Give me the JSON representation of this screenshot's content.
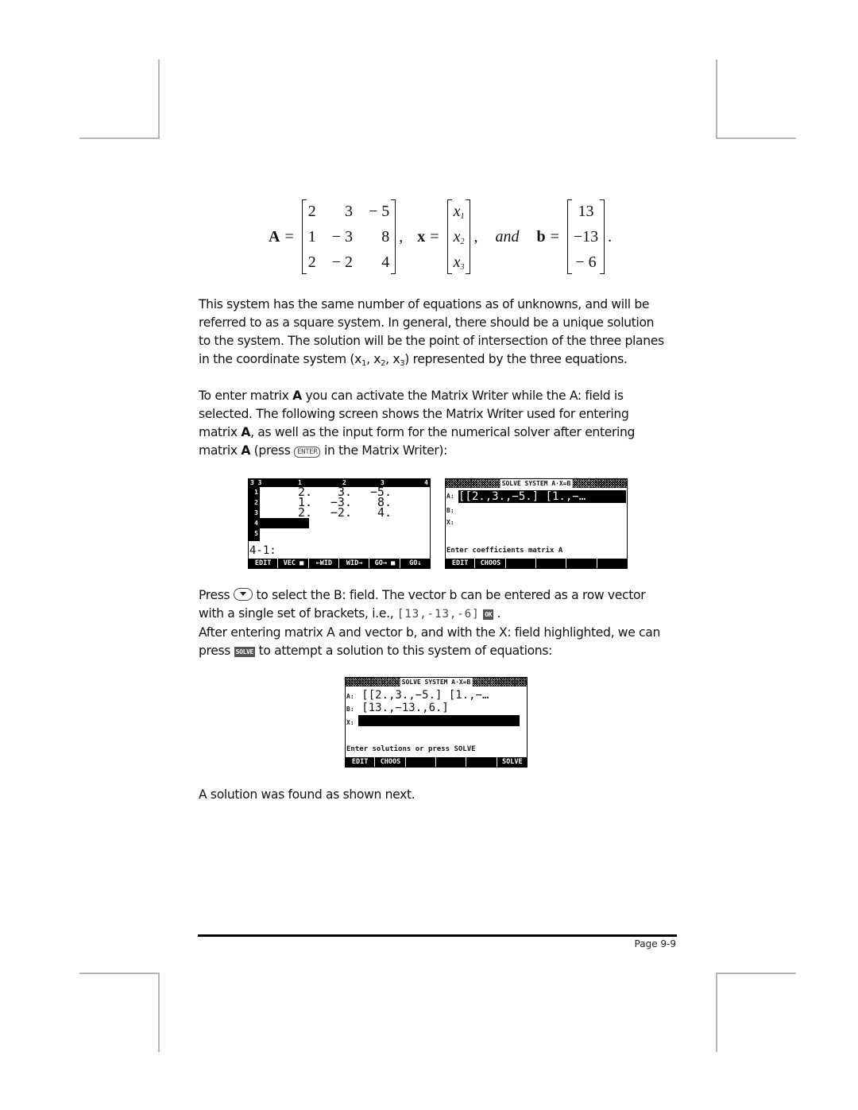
{
  "equation": {
    "A_label": "A",
    "A": [
      [
        "2",
        "3",
        "− 5"
      ],
      [
        "1",
        "− 3",
        "8"
      ],
      [
        "2",
        "− 2",
        "4"
      ]
    ],
    "x_label": "x",
    "x": [
      "x",
      "x",
      "x"
    ],
    "x_subs": [
      "1",
      "2",
      "3"
    ],
    "and_label": "and",
    "b_label": "b",
    "b": [
      "13",
      "−13",
      "− 6"
    ],
    "equals": "=",
    "comma": ",",
    "period": "."
  },
  "para1": {
    "line1": "This system has the same number of equations as of unknowns, and will be",
    "line2": "referred to as a square system.  In general, there should be a unique solution",
    "line3": "to the system.  The solution will be the point of intersection of the three planes",
    "line4_a": "in the coordinate system (x",
    "line4_s1": "1",
    "line4_b": ", x",
    "line4_s2": "2",
    "line4_c": ", x",
    "line4_s3": "3",
    "line4_d": ") represented by the three equations."
  },
  "para2": {
    "line1_a": "To enter matrix ",
    "line1_bold": "A",
    "line1_b": " you can activate the Matrix Writer while the A: field is",
    "line2": "selected.  The following screen shows the Matrix Writer used for entering",
    "line3_a": "matrix ",
    "line3_bold": "A",
    "line3_b": ", as well as the input form for the numerical solver after entering",
    "line4_a": "matrix ",
    "line4_bold": "A",
    "line4_b": " (press ",
    "enter_key": "ENTER",
    "line4_c": " in the Matrix Writer):"
  },
  "screen_matrix_writer": {
    "header": [
      "3 3",
      "1",
      "2",
      "3",
      "4"
    ],
    "row_labels": [
      "1",
      "2",
      "3",
      "4",
      "5"
    ],
    "rows": [
      [
        "2.",
        "3.",
        "−5."
      ],
      [
        "1.",
        "−3.",
        "8."
      ],
      [
        "2.",
        "−2.",
        "4."
      ]
    ],
    "command_line": "4-1:",
    "softkeys": [
      "EDIT",
      "VEC ■",
      "←WID",
      "WID→",
      "GO→ ■",
      "GO↓"
    ]
  },
  "screen_solver_1": {
    "title": "SOLVE SYSTEM A·X=B",
    "fields": [
      {
        "label": "A:",
        "value": "[[2.,3.,−5.] [1.,−…"
      },
      {
        "label": "B:",
        "value": ""
      },
      {
        "label": "X:",
        "value": ""
      }
    ],
    "help": "Enter coefficients matrix A",
    "softkeys": [
      "EDIT",
      "CHOOS",
      "",
      "",
      "",
      ""
    ]
  },
  "para3": {
    "line1_a": "Press ",
    "line1_b": " to select the B: field.  The vector b can be entered as a row vector",
    "line2_a": "with a single set of brackets, i.e., ",
    "line2_mono": "[13,-13,-6]",
    "ok_key": "OK",
    "line2_b": " .",
    "line3": "After entering matrix A and vector b, and with the X: field highlighted, we can",
    "line4_a": "press ",
    "solve_key": "SOLVE",
    "line4_b": " to attempt a solution to this system of equations:"
  },
  "screen_solver_2": {
    "title": "SOLVE SYSTEM A·X=B",
    "fields": [
      {
        "label": "A:",
        "value": "[[2.,3.,−5.] [1.,−…"
      },
      {
        "label": "B:",
        "value": "[13.,−13.,6.]"
      },
      {
        "label": "X:",
        "value": ""
      }
    ],
    "help": "Enter solutions or press SOLVE",
    "softkeys": [
      "EDIT",
      "CHOOS",
      "",
      "",
      "",
      "SOLVE"
    ]
  },
  "para4": "A solution was found as shown next.",
  "footer": {
    "page": "Page 9-9"
  }
}
